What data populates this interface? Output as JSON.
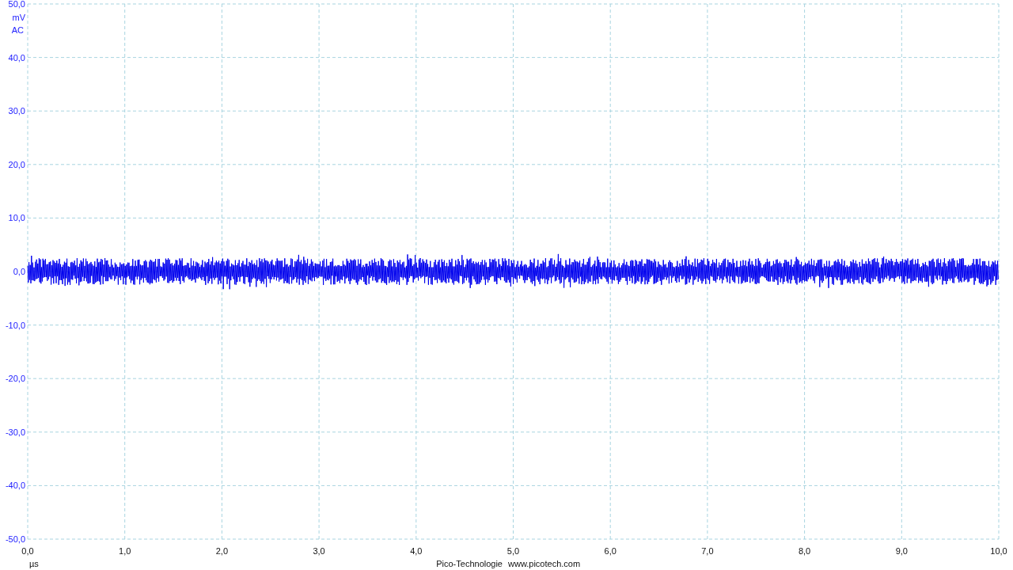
{
  "y_axis": {
    "ticks": [
      "50,0",
      "40,0",
      "30,0",
      "20,0",
      "10,0",
      "0,0",
      "-10,0",
      "-20,0",
      "-30,0",
      "-40,0",
      "-50,0"
    ],
    "unit": "mV",
    "coupling": "AC"
  },
  "x_axis": {
    "ticks": [
      "0,0",
      "1,0",
      "2,0",
      "3,0",
      "4,0",
      "5,0",
      "6,0",
      "7,0",
      "8,0",
      "9,0",
      "10,0"
    ],
    "unit": "µs"
  },
  "footer": {
    "company": "Pico-Technologie",
    "url": "www.picotech.com"
  }
}
